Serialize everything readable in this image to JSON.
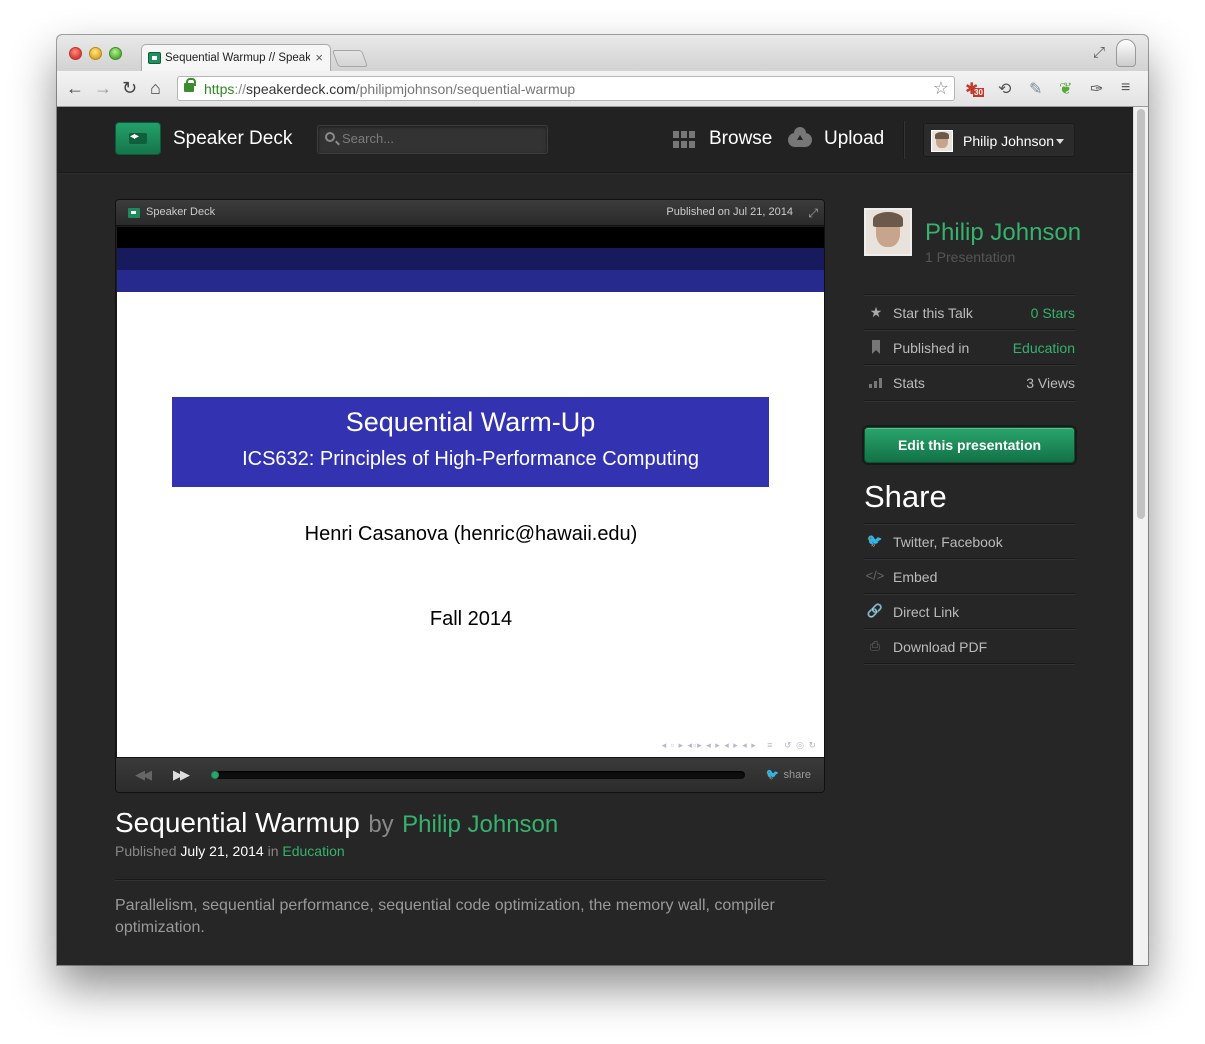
{
  "browser": {
    "tab_title": "Sequential Warmup // Speaker Deck",
    "tab_close": "×",
    "url": {
      "scheme": "https",
      "sep": "://",
      "host": "speakerdeck.com",
      "path": "/philipmjohnson/sequential-warmup"
    },
    "extensions": [
      "calendar-30-icon",
      "sync-icon",
      "eyedropper-icon",
      "evernote-icon",
      "wrench-icon",
      "menu-icon"
    ],
    "calendar_badge": "30"
  },
  "header": {
    "brand": "Speaker Deck",
    "search_placeholder": "Search...",
    "browse_label": "Browse",
    "upload_label": "Upload",
    "user_name": "Philip Johnson"
  },
  "player": {
    "brand": "Speaker Deck",
    "published": "Published on Jul 21, 2014",
    "share_label": "share",
    "progress_fraction": 0.01
  },
  "slide": {
    "title": "Sequential Warm-Up",
    "subtitle": "ICS632: Principles of High-Performance Computing",
    "author": "Henri Casanova (henric@hawaii.edu)",
    "date": "Fall 2014"
  },
  "talk": {
    "title": "Sequential Warmup",
    "by": "by",
    "author": "Philip Johnson",
    "published_prefix": "Published",
    "date": "July 21, 2014",
    "in_word": "in",
    "category": "Education",
    "description": "Parallelism, sequential performance, sequential code optimization, the memory wall, compiler optimization."
  },
  "sidebar": {
    "name": "Philip Johnson",
    "presentation_count": "1 Presentation",
    "rows": [
      {
        "label": "Star this Talk",
        "value": "0 Stars"
      },
      {
        "label": "Published in",
        "value": "Education"
      },
      {
        "label": "Stats",
        "value": "3 Views"
      }
    ],
    "edit_button": "Edit this presentation",
    "share_heading": "Share",
    "share_links": [
      {
        "label": "Twitter, Facebook"
      },
      {
        "label": "Embed"
      },
      {
        "label": "Direct Link"
      },
      {
        "label": "Download PDF"
      }
    ]
  },
  "colors": {
    "accent_green": "#35b26d",
    "page_bg": "#262626",
    "slide_blue": "#3333b2"
  }
}
